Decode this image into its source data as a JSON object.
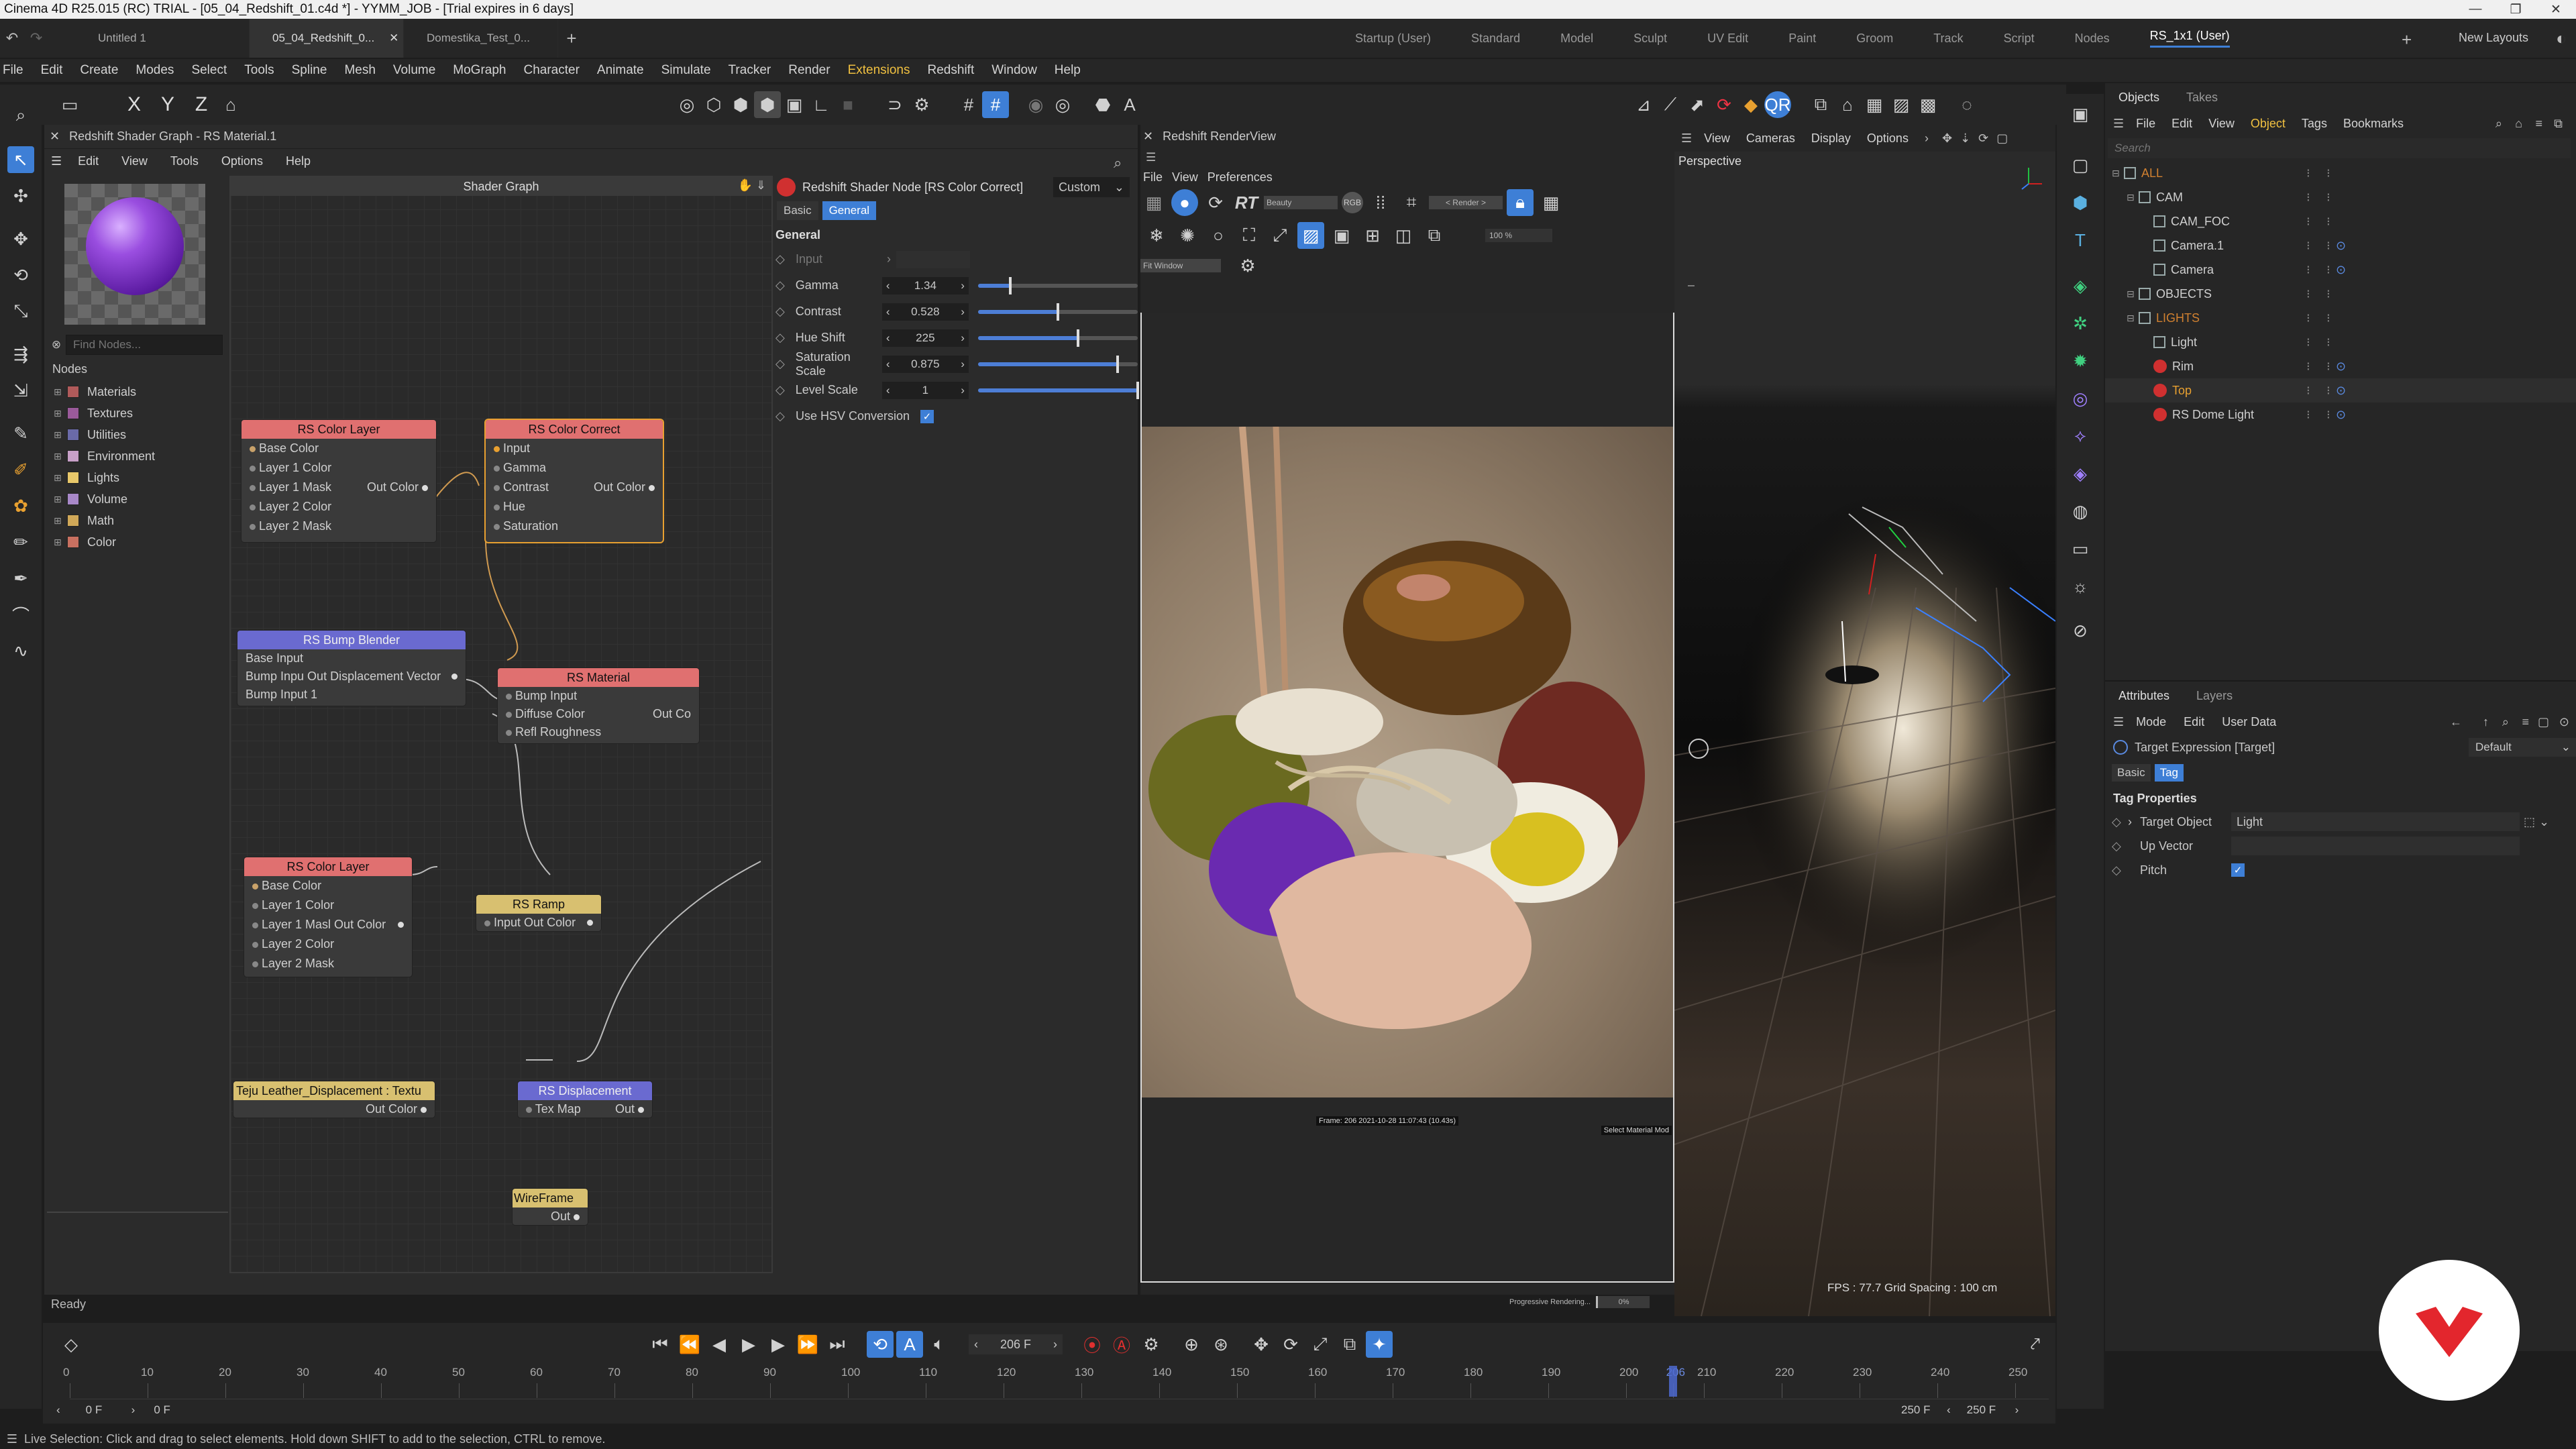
{
  "window": {
    "title": "Cinema 4D R25.015 (RC) TRIAL - [05_04_Redshift_01.c4d *] - YYMM_JOB - [Trial expires in 6 days]"
  },
  "doc_tabs": [
    "Untitled 1",
    "05_04_Redshift_0...",
    "Domestika_Test_0..."
  ],
  "layout_tabs": [
    "Startup (User)",
    "Standard",
    "Model",
    "Sculpt",
    "UV Edit",
    "Paint",
    "Groom",
    "Track",
    "Script",
    "Nodes",
    "RS_1x1 (User)"
  ],
  "new_layouts": "New Layouts",
  "main_menu": [
    "File",
    "Edit",
    "Create",
    "Modes",
    "Select",
    "Tools",
    "Spline",
    "Mesh",
    "Volume",
    "MoGraph",
    "Character",
    "Animate",
    "Simulate",
    "Tracker",
    "Render",
    "Extensions",
    "Redshift",
    "Window",
    "Help"
  ],
  "axis_buttons": [
    "X",
    "Y",
    "Z"
  ],
  "shader_graph": {
    "panel_title": "Redshift Shader Graph - RS Material.1",
    "menu": [
      "Edit",
      "View",
      "Tools",
      "Options",
      "Help"
    ],
    "find_placeholder": "Find Nodes...",
    "nodes_header": "Nodes",
    "categories": [
      {
        "label": "Materials",
        "color": "#b05a5a"
      },
      {
        "label": "Textures",
        "color": "#9a5a9a"
      },
      {
        "label": "Utilities",
        "color": "#6a6aa8"
      },
      {
        "label": "Environment",
        "color": "#c8a0c8"
      },
      {
        "label": "Lights",
        "color": "#e8c86a"
      },
      {
        "label": "Volume",
        "color": "#a888c8"
      },
      {
        "label": "Math",
        "color": "#d0a858"
      },
      {
        "label": "Color",
        "color": "#c87060"
      }
    ],
    "canvas_title": "Shader Graph",
    "nodes": {
      "color_layer_1": {
        "title": "RS Color Layer",
        "ports": [
          "Base Color",
          "Layer 1 Color",
          "Layer 1 Mask",
          "Layer 2 Color",
          "Layer 2 Mask"
        ],
        "out": "Out Color"
      },
      "color_correct": {
        "title": "RS Color Correct",
        "ports": [
          "Input",
          "Gamma",
          "Contrast",
          "Hue",
          "Saturation"
        ],
        "out": "Out Color"
      },
      "bump_blender": {
        "title": "RS Bump Blender",
        "ports": [
          "Base Input",
          "Bump Inpu Out Displacement Vector",
          "Bump Input 1"
        ]
      },
      "rs_material": {
        "title": "RS Material",
        "ports": [
          "Bump Input",
          "Diffuse Color",
          "Refl Roughness"
        ],
        "out": "Out Co"
      },
      "color_layer_2": {
        "title": "RS Color Layer",
        "ports": [
          "Base Color",
          "Layer 1 Color",
          "Layer 1 Masl Out Color",
          "Layer 2 Color",
          "Layer 2 Mask"
        ]
      },
      "rs_ramp": {
        "title": "RS Ramp",
        "ports": [
          "Input Out Color"
        ]
      },
      "texture": {
        "title": "Teju Leather_Displacement : Textu",
        "out": "Out Color"
      },
      "displacement": {
        "title": "RS Displacement",
        "ports": [
          "Tex Map"
        ],
        "out": "Out"
      },
      "wireframe": {
        "title": "WireFrame",
        "out": "Out"
      }
    }
  },
  "attr_panel": {
    "node_title": "Redshift Shader Node [RS Color Correct]",
    "preset": "Custom",
    "tabs": [
      "Basic",
      "General"
    ],
    "section": "General",
    "params": [
      {
        "label": "Input",
        "value": ""
      },
      {
        "label": "Gamma",
        "value": "1.34",
        "fill": 0.2
      },
      {
        "label": "Contrast",
        "value": "0.528",
        "fill": 0.5
      },
      {
        "label": "Hue Shift",
        "value": "225",
        "fill": 0.625
      },
      {
        "label": "Saturation Scale",
        "value": "0.875",
        "fill": 0.875
      },
      {
        "label": "Level Scale",
        "value": "1",
        "fill": 1.0
      }
    ],
    "checkbox_label": "Use HSV Conversion"
  },
  "renderview": {
    "title": "Redshift RenderView",
    "menu": [
      "File",
      "View",
      "Preferences"
    ],
    "aov": "Beauty",
    "channel": "RGB",
    "render_btn": "< Render >",
    "window_select": "Fit Window",
    "zoom": "100 %",
    "frame_info": "Frame: 206 2021-10-28 11:07:43 (10.43s)",
    "select_mode": "Select Material Mod",
    "progress_label": "Progressive Rendering...",
    "progress_value": "0%"
  },
  "viewport": {
    "menu": [
      "View",
      "Cameras",
      "Display",
      "Options"
    ],
    "label": "Perspective",
    "fps": "FPS : 77.7  Grid Spacing : 100 cm"
  },
  "objects": {
    "tabs": [
      "Objects",
      "Takes"
    ],
    "menu": [
      "File",
      "Edit",
      "View",
      "Object",
      "Tags",
      "Bookmarks"
    ],
    "search_placeholder": "Search",
    "rows": [
      {
        "label": "ALL",
        "indent": 0,
        "color": "#d08030"
      },
      {
        "label": "CAM",
        "indent": 1,
        "color": "#cfcfcf"
      },
      {
        "label": "CAM_FOC",
        "indent": 2,
        "color": "#cfcfcf"
      },
      {
        "label": "Camera.1",
        "indent": 2,
        "color": "#cfcfcf"
      },
      {
        "label": "Camera",
        "indent": 2,
        "color": "#cfcfcf"
      },
      {
        "label": "OBJECTS",
        "indent": 1,
        "color": "#cfcfcf"
      },
      {
        "label": "LIGHTS",
        "indent": 1,
        "color": "#d08030"
      },
      {
        "label": "Light",
        "indent": 2,
        "color": "#cfcfcf"
      },
      {
        "label": "Rim",
        "indent": 2,
        "color": "#cfcfcf"
      },
      {
        "label": "Top",
        "indent": 2,
        "color": "#e8a030"
      },
      {
        "label": "RS Dome Light",
        "indent": 2,
        "color": "#cfcfcf"
      }
    ]
  },
  "attributes": {
    "tabs": [
      "Attributes",
      "Layers"
    ],
    "menu": [
      "Mode",
      "Edit",
      "User Data"
    ],
    "object": "Target Expression [Target]",
    "mode_value": "Default",
    "subtabs": [
      "Basic",
      "Tag"
    ],
    "section": "Tag Properties",
    "params": [
      {
        "label": "Target Object",
        "value": "Light"
      },
      {
        "label": "Up Vector",
        "value": ""
      },
      {
        "label": "Pitch",
        "value": ""
      }
    ]
  },
  "status_ready": "Ready",
  "timeline": {
    "current_frame": "206 F",
    "start": "0 F",
    "start2": "0 F",
    "end": "250 F",
    "end2": "250 F",
    "ticks": [
      "0",
      "10",
      "20",
      "30",
      "40",
      "50",
      "60",
      "70",
      "80",
      "90",
      "100",
      "110",
      "120",
      "130",
      "140",
      "150",
      "160",
      "170",
      "180",
      "190",
      "200",
      "206",
      "210",
      "220",
      "230",
      "240",
      "250"
    ],
    "playhead": 206
  },
  "status_bar": "Live Selection: Click and drag to select elements. Hold down SHIFT to add to the selection, CTRL to remove.",
  "colors": {
    "accent": "#4d7ed6",
    "active_tab": "#3e7fd6",
    "logo_red": "#e3262d"
  }
}
